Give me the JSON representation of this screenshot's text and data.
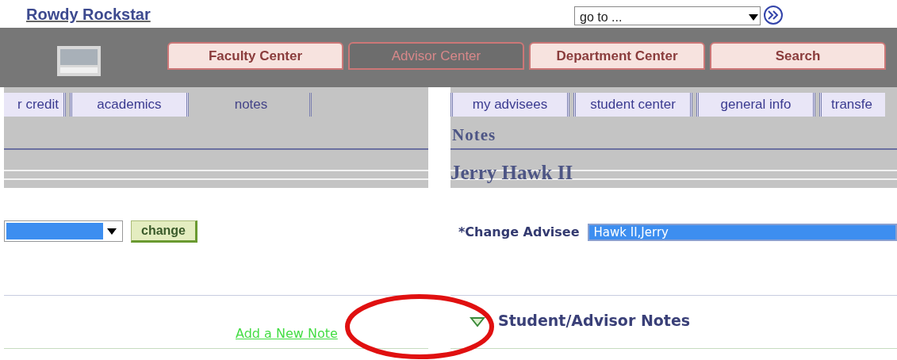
{
  "header": {
    "name": "Rowdy Rockstar",
    "goto": {
      "value": "go to ..."
    }
  },
  "main_tabs": [
    {
      "label": "Faculty Center",
      "selected": false
    },
    {
      "label": "Advisor Center",
      "selected": true
    },
    {
      "label": "Department Center",
      "selected": false
    },
    {
      "label": "Search",
      "selected": false
    }
  ],
  "left": {
    "sub_tabs": [
      {
        "label": "r credit",
        "selected": false
      },
      {
        "label": "academics",
        "selected": false
      },
      {
        "label": "notes",
        "selected": true
      }
    ],
    "change_button": "change",
    "link": "Add a New Note"
  },
  "right": {
    "sub_tabs": [
      {
        "label": "my advisees",
        "selected": false
      },
      {
        "label": "student center",
        "selected": false
      },
      {
        "label": "general info",
        "selected": false
      },
      {
        "label": "transfe",
        "selected": false
      }
    ],
    "page_title": "Notes",
    "student_name": "Jerry Hawk II",
    "advisee_label": "*Change Advisee",
    "advisee_value": "Hawk II,Jerry",
    "section": {
      "title": "Student/Advisor Notes",
      "expanded": true
    }
  }
}
